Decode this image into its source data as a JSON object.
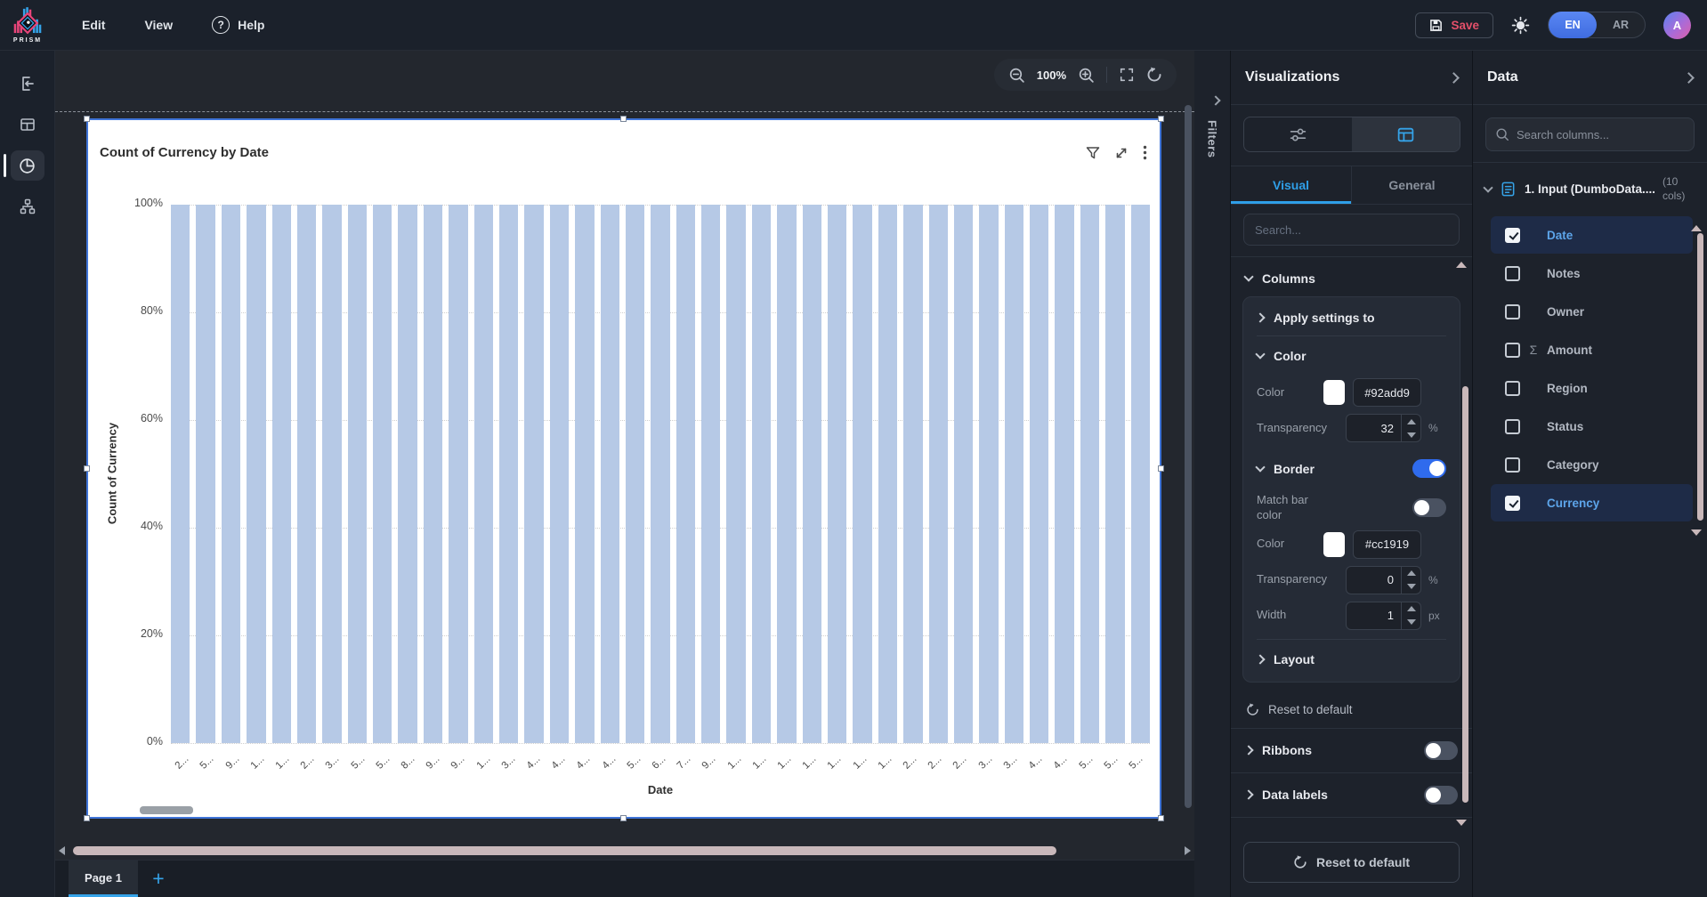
{
  "topbar": {
    "logo_text": "PRISM",
    "menus": [
      {
        "label": "Edit"
      },
      {
        "label": "View"
      },
      {
        "label": "Help"
      }
    ],
    "save_label": "Save",
    "lang_en": "EN",
    "lang_ar": "AR",
    "avatar_initial": "A"
  },
  "canvas": {
    "zoom_level": "100%",
    "page_tab_label": "Page 1",
    "add_page_label": "+"
  },
  "filters_strip": {
    "label": "Filters"
  },
  "chart_data": {
    "type": "bar",
    "title": "Count of Currency by Date",
    "xlabel": "Date",
    "ylabel": "Count of Currency",
    "ylim": [
      0,
      100
    ],
    "y_tick_labels": [
      "100%",
      "80%",
      "60%",
      "40%",
      "20%",
      "0%"
    ],
    "x_tick_labels": [
      "2...",
      "5...",
      "9...",
      "1...",
      "1...",
      "2...",
      "3...",
      "5...",
      "5...",
      "8...",
      "9...",
      "9...",
      "1...",
      "3...",
      "4...",
      "4...",
      "4...",
      "4...",
      "5...",
      "6...",
      "7...",
      "9...",
      "1...",
      "1...",
      "1...",
      "1...",
      "1...",
      "1...",
      "1...",
      "2...",
      "2...",
      "2...",
      "3...",
      "3...",
      "4...",
      "4...",
      "5...",
      "5...",
      "5..."
    ],
    "values": [
      100,
      100,
      100,
      100,
      100,
      100,
      100,
      100,
      100,
      100,
      100,
      100,
      100,
      100,
      100,
      100,
      100,
      100,
      100,
      100,
      100,
      100,
      100,
      100,
      100,
      100,
      100,
      100,
      100,
      100,
      100,
      100,
      100,
      100,
      100,
      100,
      100,
      100,
      100
    ],
    "bar_color": "#b6c9e6",
    "grid": "horizontal-dotted",
    "legend": "none"
  },
  "visualizations": {
    "title": "Visualizations",
    "tabs": [
      {
        "label": "Visual"
      },
      {
        "label": "General"
      }
    ],
    "search_placeholder": "Search...",
    "columns_section": {
      "label": "Columns",
      "apply_settings": "Apply settings to",
      "color_group": {
        "label": "Color",
        "color_label": "Color",
        "color_hex": "#92add9",
        "transparency_label": "Transparency",
        "transparency_value": "32",
        "transparency_unit": "%"
      },
      "border_group": {
        "label": "Border",
        "enabled": true,
        "match_bar_color_label": "Match bar color",
        "match_bar_color_enabled": false,
        "color_label": "Color",
        "color_hex": "#cc1919",
        "transparency_label": "Transparency",
        "transparency_value": "0",
        "transparency_unit": "%",
        "width_label": "Width",
        "width_value": "1",
        "width_unit": "px"
      },
      "layout_label": "Layout",
      "reset_link": "Reset to default"
    },
    "ribbons": {
      "label": "Ribbons",
      "enabled": false
    },
    "data_labels": {
      "label": "Data labels",
      "enabled": false
    },
    "reset_button": "Reset to default"
  },
  "data_panel": {
    "title": "Data",
    "search_placeholder": "Search columns...",
    "source": {
      "name": "1. Input (DumboData....",
      "cols_badge": "(10 cols)"
    },
    "sigma_glyph": "Σ",
    "fields": [
      {
        "name": "Date",
        "checked": true,
        "aggregate": false
      },
      {
        "name": "Notes",
        "checked": false,
        "aggregate": false
      },
      {
        "name": "Owner",
        "checked": false,
        "aggregate": false
      },
      {
        "name": "Amount",
        "checked": false,
        "aggregate": true
      },
      {
        "name": "Region",
        "checked": false,
        "aggregate": false
      },
      {
        "name": "Status",
        "checked": false,
        "aggregate": false
      },
      {
        "name": "Category",
        "checked": false,
        "aggregate": false
      },
      {
        "name": "Currency",
        "checked": true,
        "aggregate": false
      }
    ]
  },
  "colors": {
    "accent": "#35a3e8",
    "toggle_on": "#2f6bed",
    "save_text": "#e4506a",
    "bar_fill_rendered": "#b6c9e6",
    "selection_border": "#3f74d8"
  }
}
